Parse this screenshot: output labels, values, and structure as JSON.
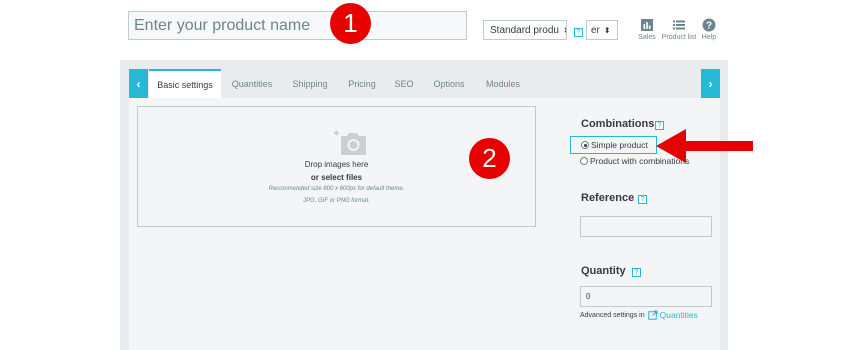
{
  "header": {
    "name_placeholder": "Enter your product name",
    "product_type": "Standard produ",
    "language": "er",
    "help_mark": "?",
    "tools": [
      {
        "label": "Sales",
        "icon": "sales-chart-icon"
      },
      {
        "label": "Product list",
        "icon": "list-icon"
      },
      {
        "label": "Help",
        "icon": "help-circle-icon"
      }
    ]
  },
  "tabs": [
    "Basic settings",
    "Quantities",
    "Shipping",
    "Pricing",
    "SEO",
    "Options",
    "Modules"
  ],
  "nav": {
    "prev": "‹",
    "next": "›"
  },
  "images": {
    "drop_text": "Drop images here",
    "select_text": "or select files",
    "hint_line1": "Recommended size 800 x 800px for default theme.",
    "hint_line2": "JPG, GIF or PNG format."
  },
  "combinations": {
    "title": "Combinations",
    "options": [
      "Simple product",
      "Product with combinations"
    ],
    "selected": "Simple product"
  },
  "reference": {
    "title": "Reference",
    "value": ""
  },
  "quantity": {
    "title": "Quantity",
    "value": "0"
  },
  "advanced": {
    "prefix": "Advanced settings in",
    "link": "Quantities"
  },
  "annotations": [
    "1",
    "2"
  ],
  "colors": {
    "accent": "#25b9d7",
    "annotation_red": "#e60000",
    "text": "#363a41"
  }
}
